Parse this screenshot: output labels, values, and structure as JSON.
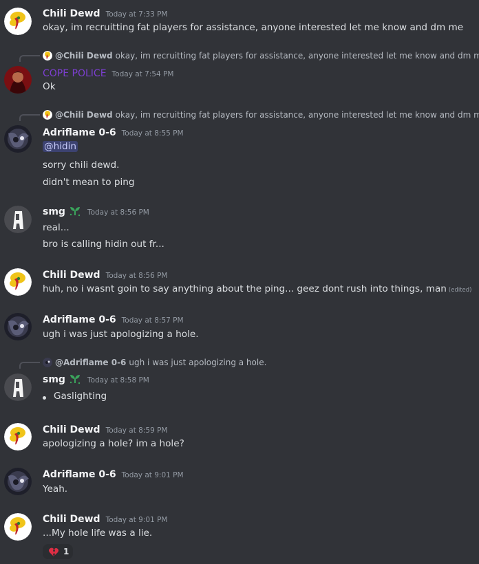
{
  "users": {
    "chili": "Chili Dewd",
    "cope": "COPE POLICE",
    "adri": "Adriflame 0-6",
    "smg": "smg"
  },
  "messages": [
    {
      "author": "Chili Dewd",
      "time": "Today at 7:33 PM",
      "text": "okay, im recruitting fat players for assistance, anyone interested let me know and dm me"
    },
    {
      "reply_author": "@Chili Dewd",
      "reply_text": "okay, im recruitting fat players for assistance, anyone interested let me know and dm me",
      "author": "COPE POLICE",
      "time": "Today at 7:54 PM",
      "text": "Ok"
    },
    {
      "reply_author": "@Chili Dewd",
      "reply_text": "okay, im recruitting fat players for assistance, anyone interested let me know and dm me",
      "author": "Adriflame 0-6",
      "time": "Today at 8:55 PM",
      "mention": "@hidin",
      "line2": "sorry chili dewd.",
      "line3": "didn't mean to ping"
    },
    {
      "author": "smg",
      "time": "Today at 8:56 PM",
      "text": "real...",
      "line2": "bro is calling hidin out fr..."
    },
    {
      "author": "Chili Dewd",
      "time": "Today at 8:56 PM",
      "text": "huh, no i wasnt goin to say anything about the ping... geez dont rush into things, man",
      "edited": "(edited)"
    },
    {
      "author": "Adriflame 0-6",
      "time": "Today at 8:57 PM",
      "text": "ugh i was just apologizing a hole."
    },
    {
      "reply_author": "@Adriflame 0-6",
      "reply_text": "ugh i was just apologizing a hole.",
      "author": "smg",
      "time": "Today at 8:58 PM",
      "bullet": "Gaslighting"
    },
    {
      "author": "Chili Dewd",
      "time": "Today at 8:59 PM",
      "text": "apologizing a hole? im a hole?"
    },
    {
      "author": "Adriflame 0-6",
      "time": "Today at 9:01 PM",
      "text": "Yeah."
    },
    {
      "author": "Chili Dewd",
      "time": "Today at 9:01 PM",
      "text": "...My hole life was a lie.",
      "reaction": {
        "emoji": "broken-heart",
        "count": "1"
      }
    }
  ],
  "colors": {
    "background": "#313338",
    "cope_role": "#7c3fd0",
    "mention_bg": "#3c4270",
    "badge_green": "#3ba55c",
    "reaction_heart": "#dd2e44"
  },
  "icons": {
    "smg_badge": "sprout-badge-icon",
    "reaction": "broken-heart-icon"
  }
}
